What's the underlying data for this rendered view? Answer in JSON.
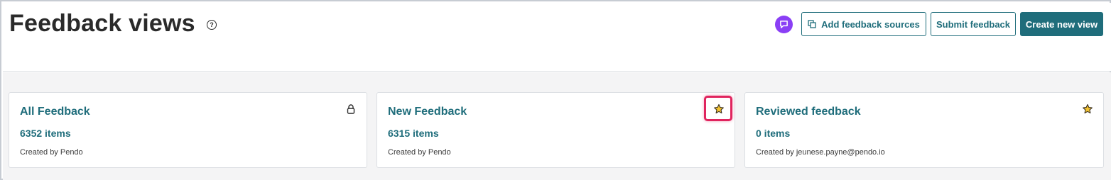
{
  "header": {
    "title": "Feedback views",
    "help_icon": "question-circle-icon",
    "help_glyph": "?",
    "chat_icon": "chat-bubble-icon",
    "chat_color": "#8a3ff5",
    "buttons": {
      "add_sources": "Add feedback sources",
      "submit": "Submit feedback",
      "create": "Create new view"
    }
  },
  "views": [
    {
      "title": "All Feedback",
      "count": "6352 items",
      "creator": "Created by Pendo",
      "icon": "lock-icon"
    },
    {
      "title": "New Feedback",
      "count": "6315 items",
      "creator": "Created by Pendo",
      "icon": "star-icon",
      "highlighted": true
    },
    {
      "title": "Reviewed feedback",
      "count": "0 items",
      "creator": "Created by jeunese.payne@pendo.io",
      "icon": "star-icon"
    }
  ],
  "colors": {
    "accent": "#1f6d7b",
    "star": "#f2c230",
    "highlight": "#e0245e",
    "background": "#f4f4f5"
  }
}
